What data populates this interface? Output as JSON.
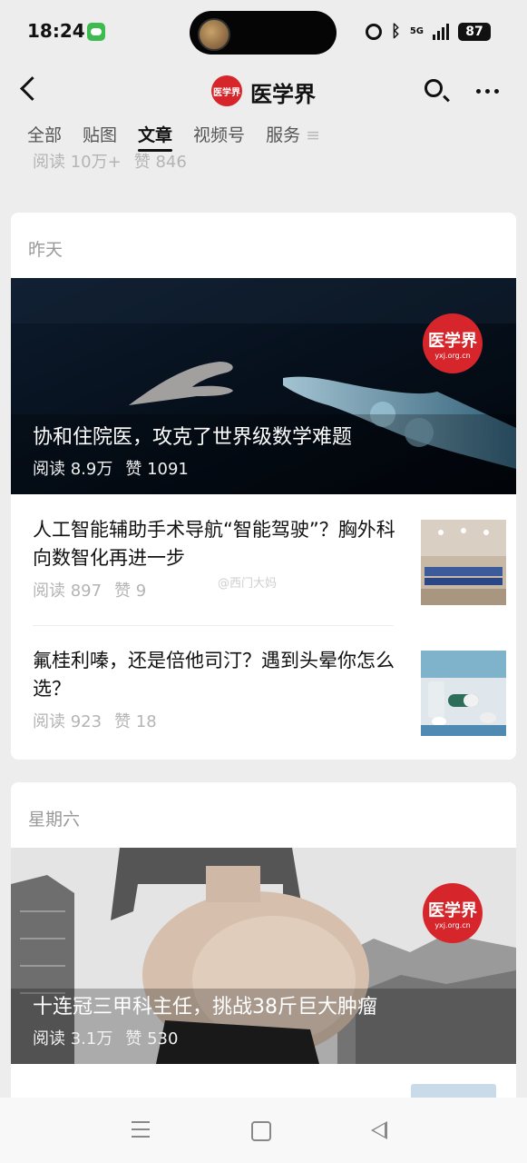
{
  "status": {
    "time": "18:24",
    "network": "5G",
    "battery": "87"
  },
  "header": {
    "account_name": "医学界",
    "logo_text": "医学界"
  },
  "tabs": [
    {
      "label": "全部",
      "active": false
    },
    {
      "label": "贴图",
      "active": false
    },
    {
      "label": "文章",
      "active": true
    },
    {
      "label": "视频号",
      "active": false
    },
    {
      "label": "服务",
      "active": false
    }
  ],
  "tab_more": "≡",
  "sticky_stats": {
    "reads": "阅读 10万+",
    "likes": "赞 846"
  },
  "sections": [
    {
      "date": "昨天",
      "hero": {
        "title": "协和住院医，攻克了世界级数学难题",
        "reads": "阅读 8.9万",
        "likes": "赞 1091",
        "logo_name": "医学界",
        "logo_url": "yxj.org.cn"
      },
      "items": [
        {
          "title": "人工智能辅助手术导航“智能驾驶”？胸外科向数智化再进一步",
          "reads": "阅读 897",
          "likes": "赞 9"
        },
        {
          "title": "氟桂利嗪，还是倍他司汀？遇到头晕你怎么选？",
          "reads": "阅读 923",
          "likes": "赞 18"
        }
      ]
    },
    {
      "date": "星期六",
      "hero": {
        "title": "十连冠三甲科主任，挑战38斤巨大肿瘤",
        "reads": "阅读 3.1万",
        "likes": "赞 530",
        "logo_name": "医学界",
        "logo_url": "yxj.org.cn"
      }
    }
  ],
  "watermark": "@西门大妈",
  "colors": {
    "accent": "#d7262b",
    "background": "#ededed",
    "card": "#ffffff",
    "muted_text": "#b4b4b4"
  }
}
